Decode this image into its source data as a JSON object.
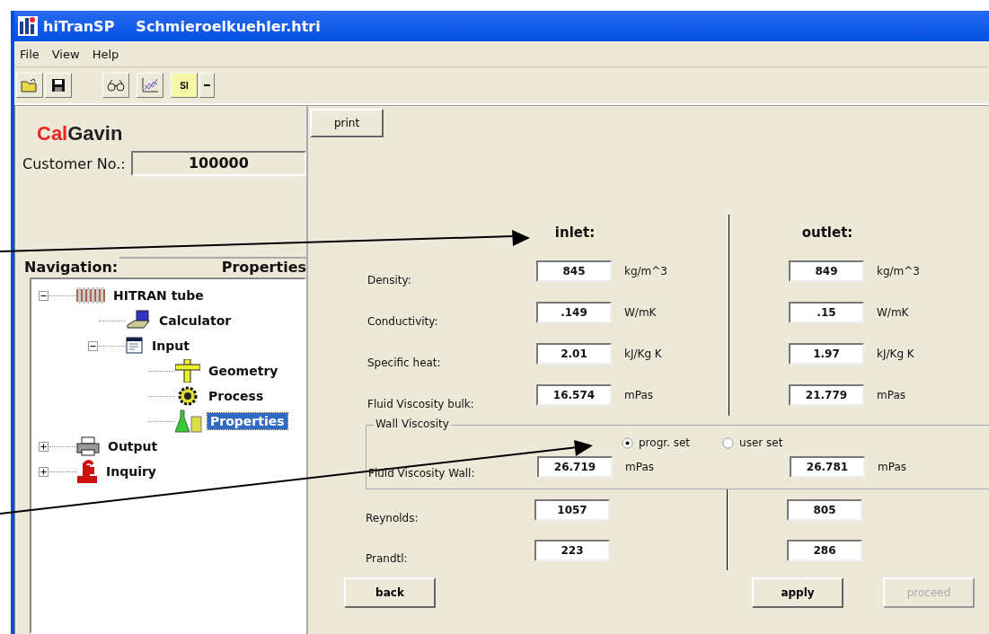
{
  "window": {
    "app": "hiTranSP",
    "file": "Schmieroelkuehler.htri"
  },
  "menu": [
    "File",
    "View",
    "Help"
  ],
  "toolbar": {
    "units": "SI"
  },
  "logo": {
    "first": "Cal",
    "second": "Gavin"
  },
  "customer": {
    "label": "Customer No.:",
    "value": "100000"
  },
  "navigation": {
    "label": "Navigation:",
    "current": "Properties"
  },
  "tree": [
    {
      "label": "HITRAN tube",
      "kind": "tube",
      "expanded": true,
      "selected": false,
      "children": [
        {
          "label": "Calculator",
          "kind": "laptop",
          "selected": false
        },
        {
          "label": "Input",
          "kind": "form",
          "expanded": true,
          "selected": false,
          "children": [
            {
              "label": "Geometry",
              "kind": "ruler",
              "selected": false
            },
            {
              "label": "Process",
              "kind": "gear",
              "selected": false
            },
            {
              "label": "Properties",
              "kind": "flask",
              "selected": true
            }
          ]
        }
      ]
    },
    {
      "label": "Output",
      "kind": "printer",
      "expanded": false,
      "selected": false
    },
    {
      "label": "Inquiry",
      "kind": "pound",
      "expanded": false,
      "selected": false
    }
  ],
  "print_button": "print",
  "headings": [
    "inlet:",
    "outlet:"
  ],
  "rows": [
    {
      "label": "Density:",
      "inlet": "845",
      "inlet_unit": "kg/m^3",
      "outlet": "849",
      "outlet_unit": "kg/m^3"
    },
    {
      "label": "Conductivity:",
      "inlet": ".149",
      "inlet_unit": "W/mK",
      "outlet": ".15",
      "outlet_unit": "W/mK"
    },
    {
      "label": "Specific heat:",
      "inlet": "2.01",
      "inlet_unit": "kJ/Kg K",
      "outlet": "1.97",
      "outlet_unit": "kJ/Kg K"
    },
    {
      "label": "Fluid Viscosity bulk:",
      "inlet": "16.574",
      "inlet_unit": "mPas",
      "outlet": "21.779",
      "outlet_unit": "mPas"
    }
  ],
  "wall": {
    "title": "Wall Viscosity",
    "options": [
      {
        "label": "progr. set",
        "selected": true
      },
      {
        "label": "user set",
        "selected": false
      }
    ],
    "row": {
      "label": "Fluid Viscosity Wall:",
      "inlet": "26.719",
      "inlet_unit": "mPas",
      "outlet": "26.781",
      "outlet_unit": "mPas"
    }
  },
  "numbers": [
    {
      "label": "Reynolds:",
      "inlet": "1057",
      "outlet": "805"
    },
    {
      "label": "Prandtl:",
      "inlet": "223",
      "outlet": "286"
    }
  ],
  "buttons": [
    {
      "label": "back",
      "disabled": false
    },
    {
      "label": "apply",
      "disabled": false
    },
    {
      "label": "proceed",
      "disabled": true
    }
  ]
}
